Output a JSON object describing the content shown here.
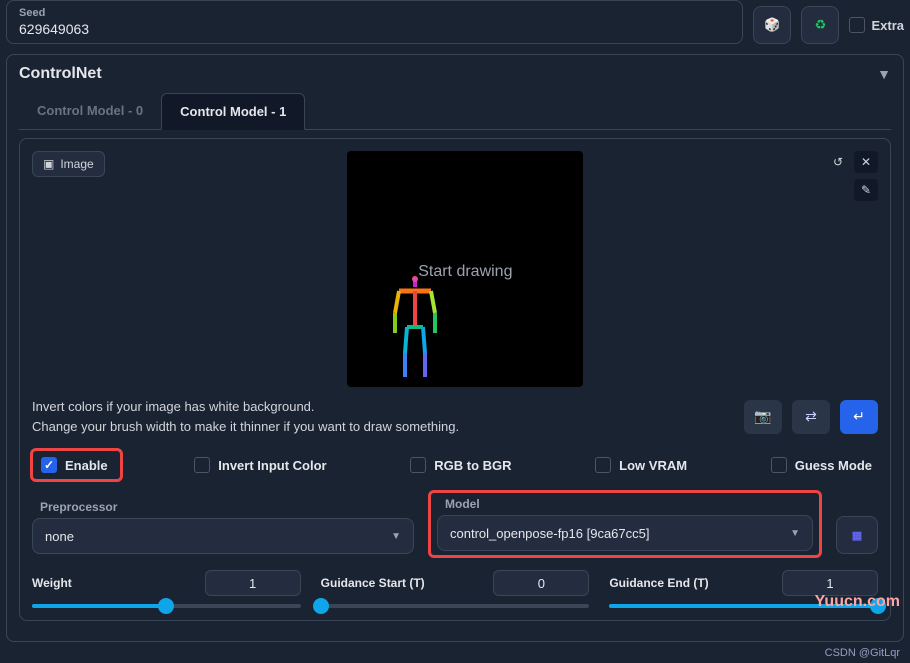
{
  "seed": {
    "label": "Seed",
    "value": "629649063"
  },
  "extra_label": "Extra",
  "panel": {
    "title": "ControlNet"
  },
  "tabs": {
    "t0": "Control Model - 0",
    "t1": "Control Model - 1"
  },
  "image_btn": "Image",
  "canvas_text": "Start drawing",
  "hint": {
    "line1": "Invert colors if your image has white background.",
    "line2": "Change your brush width to make it thinner if you want to draw something."
  },
  "checks": {
    "enable": "Enable",
    "invert": "Invert Input Color",
    "rgb": "RGB to BGR",
    "lowvram": "Low VRAM",
    "guess": "Guess Mode"
  },
  "preproc": {
    "label": "Preprocessor",
    "value": "none"
  },
  "model": {
    "label": "Model",
    "value": "control_openpose-fp16 [9ca67cc5]"
  },
  "sliders": {
    "weight": {
      "label": "Weight",
      "value": "1",
      "pct": 50
    },
    "gstart": {
      "label": "Guidance Start (T)",
      "value": "0",
      "pct": 0
    },
    "gend": {
      "label": "Guidance End (T)",
      "value": "1",
      "pct": 100
    }
  },
  "watermark1": "Yuucn.com",
  "watermark2": "CSDN @GitLqr",
  "icons": {
    "dice": "🎲",
    "recycle": "♻",
    "undo": "↺",
    "close": "✕",
    "pencil": "✎",
    "camera": "📷",
    "swap": "⇄",
    "redo_down": "↵",
    "run": "▦"
  }
}
